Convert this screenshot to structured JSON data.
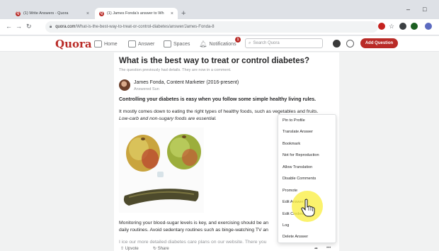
{
  "browser": {
    "tabs": [
      {
        "label": "(1) Write Answers - Quora"
      },
      {
        "label": "(1) James Fonda's answer to Wh"
      }
    ],
    "new_tab_symbol": "+",
    "close_symbol": "×",
    "url_host": "quora.com",
    "url_path": "/What-is-the-best-way-to-treat-or-control-diabetes/answer/James-Fonda-8"
  },
  "header": {
    "logo": "Quora",
    "nav": [
      {
        "label": "Home",
        "icon": "home-icon"
      },
      {
        "label": "Answer",
        "icon": "answer-icon"
      },
      {
        "label": "Spaces",
        "icon": "spaces-icon"
      },
      {
        "label": "Notifications",
        "icon": "bell-icon"
      }
    ],
    "notification_count": "1",
    "search_placeholder": "Search Quora",
    "add_question_label": "Add Question"
  },
  "question": {
    "title": "What is the best way to treat or control diabetes?",
    "subtitle": "The question previously had details. They are now in a comment."
  },
  "answer": {
    "author": "James Fonda, Content Marketer (2016-present)",
    "date": "Answered Sun",
    "lead": "Controlling your diabetes is easy when you follow some simple healthy living rules.",
    "p1": "It mostly comes down to eating the right types of healthy foods, such as vegetables and fruits.",
    "p2": "Low-carb and non-sugary foods are essential.",
    "p3": "Monitoring your blood-sugar levels is key, and exercising should be an",
    "p4": "daily routines. Avoid sedentary routines such as binge-watching TV an",
    "p5": "I ice our more detailed diabetes care plans on our website. There you"
  },
  "actions": {
    "upvote": "Upvote",
    "share": "Share",
    "more": "•••"
  },
  "menu": {
    "items": [
      "Pin to Profile",
      "Translate Answer",
      "Bookmark",
      "Not for Reproduction",
      "Allow Translation",
      "Disable Comments",
      "Promote",
      "Edit Answer",
      "Edit Credential",
      "Log",
      "Delete Answer"
    ]
  },
  "colors": {
    "brand": "#b92b27",
    "cursor_highlight": "#faee3c"
  }
}
